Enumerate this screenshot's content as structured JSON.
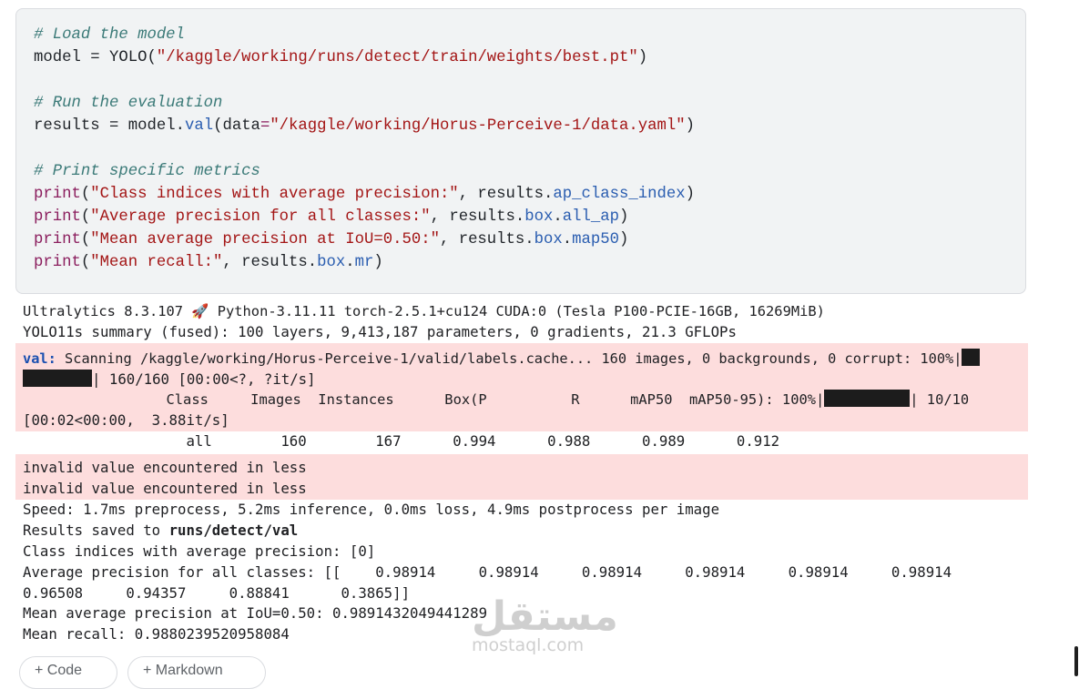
{
  "code_cell": {
    "comment_load": "# Load the model",
    "model_var": "model",
    "eq": " = ",
    "yolo_call": "YOLO(",
    "weights_path": "\"/kaggle/working/runs/detect/train/weights/best.pt\"",
    "close_paren": ")",
    "comment_eval": "# Run the evaluation",
    "results_var": "results",
    "model_dot": "model.",
    "val_method": "val",
    "data_arg_open": "(data",
    "data_eq": "=",
    "data_path": "\"/kaggle/working/Horus-Perceive-1/data.yaml\"",
    "comment_print": "# Print specific metrics",
    "print_kw": "print",
    "str1": "\"Class indices with average precision:\"",
    "attr1": "ap_class_index",
    "str2": "\"Average precision for all classes:\"",
    "attr2": "box",
    "attr2b": "all_ap",
    "str3": "\"Mean average precision at IoU=0.50:\"",
    "attr3": "box",
    "attr3b": "map50",
    "str4": "\"Mean recall:\"",
    "attr4": "box",
    "attr4b": "mr",
    "results_dot": ", results.",
    "dot": "."
  },
  "output": {
    "line1": "Ultralytics 8.3.107 🚀 Python-3.11.11 torch-2.5.1+cu124 CUDA:0 (Tesla P100-PCIE-16GB, 16269MiB)",
    "line2": "YOLO11s summary (fused): 100 layers, 9,413,187 parameters, 0 gradients, 21.3 GFLOPs",
    "val_tag": "val:",
    "scan_line": " Scanning /kaggle/working/Horus-Perceive-1/valid/labels.cache... 160 images, 0 backgrounds, 0 corrupt: 100%|",
    "scan_line2": "| 160/160 [00:00<?, ?it/s]",
    "header_line": "                 Class     Images  Instances      Box(P          R      mAP50  mAP50-95): 100%|",
    "header_tail": "| 10/10",
    "header_line2": "[00:02<00:00,  3.88it/s]",
    "results_row": "                   all        160        167      0.994      0.988      0.989      0.912",
    "warn1": "invalid value encountered in less",
    "warn2": "invalid value encountered in less",
    "speed": "Speed: 1.7ms preprocess, 5.2ms inference, 0.0ms loss, 4.9ms postprocess per image",
    "saved_prefix": "Results saved to ",
    "saved_path": "runs/detect/val",
    "class_indices": "Class indices with average precision: [0]",
    "ap_line1": "Average precision for all classes: [[    0.98914     0.98914     0.98914     0.98914     0.98914     0.98914",
    "ap_line2": "0.96508     0.94357     0.88841      0.3865]]",
    "map50": "Mean average precision at IoU=0.50: 0.9891432049441289",
    "mean_recall": "Mean recall: 0.9880239520958084"
  },
  "watermark": {
    "arabic": "مستقل",
    "latin": "mostaql.com"
  },
  "buttons": {
    "code": "+ Code",
    "markdown": "+ Markdown"
  },
  "progress": {
    "scan": 1.0,
    "eval": 1.0
  }
}
